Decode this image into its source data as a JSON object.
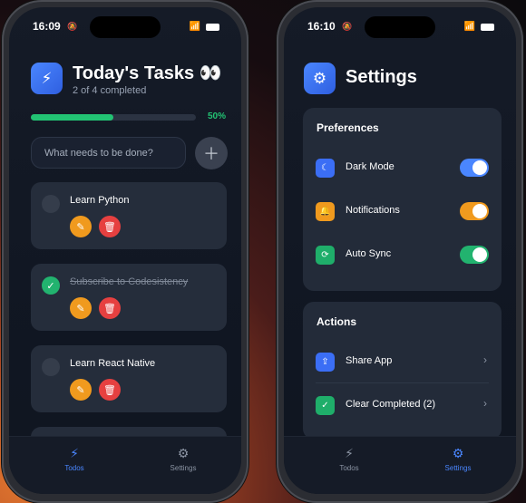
{
  "left_phone": {
    "status": {
      "time": "16:09"
    },
    "header": {
      "title": "Today's Tasks 👀",
      "subtitle": "2 of 4 completed"
    },
    "progress": {
      "fraction": 0.5,
      "label": "50%",
      "color": "#22c373"
    },
    "new_task": {
      "placeholder": "What needs to be done?"
    },
    "tasks": [
      {
        "text": "Learn Python",
        "done": false
      },
      {
        "text": "Subscribe to Codesistency",
        "done": true
      },
      {
        "text": "Learn React Native",
        "done": false
      }
    ],
    "tabs": [
      {
        "label": "Todos",
        "icon": "lightning-icon",
        "active": true
      },
      {
        "label": "Settings",
        "icon": "gear-icon",
        "active": false
      }
    ]
  },
  "right_phone": {
    "status": {
      "time": "16:10"
    },
    "header": {
      "title": "Settings"
    },
    "preferences": {
      "title": "Preferences",
      "items": [
        {
          "label": "Dark Mode",
          "icon": "moon-icon",
          "on": true,
          "icon_color": "#3b6ef5",
          "toggle_color": "#4a86ff"
        },
        {
          "label": "Notifications",
          "icon": "bell-icon",
          "on": true,
          "icon_color": "#f09a1e",
          "toggle_color": "#f09a1e"
        },
        {
          "label": "Auto Sync",
          "icon": "sync-icon",
          "on": true,
          "icon_color": "#1fae6a",
          "toggle_color": "#22b36f"
        }
      ]
    },
    "actions": {
      "title": "Actions",
      "items": [
        {
          "label": "Share App",
          "icon": "share-icon",
          "icon_color": "#3b6ef5"
        },
        {
          "label": "Clear Completed (2)",
          "icon": "checkmark-icon",
          "icon_color": "#1fae6a"
        }
      ]
    },
    "tabs": [
      {
        "label": "Todos",
        "icon": "lightning-icon",
        "active": false
      },
      {
        "label": "Settings",
        "icon": "gear-icon",
        "active": true
      }
    ]
  },
  "colors": {
    "accent": "#4a86ff",
    "success": "#22c373",
    "edit": "#f09a1e",
    "delete": "#e64040"
  }
}
